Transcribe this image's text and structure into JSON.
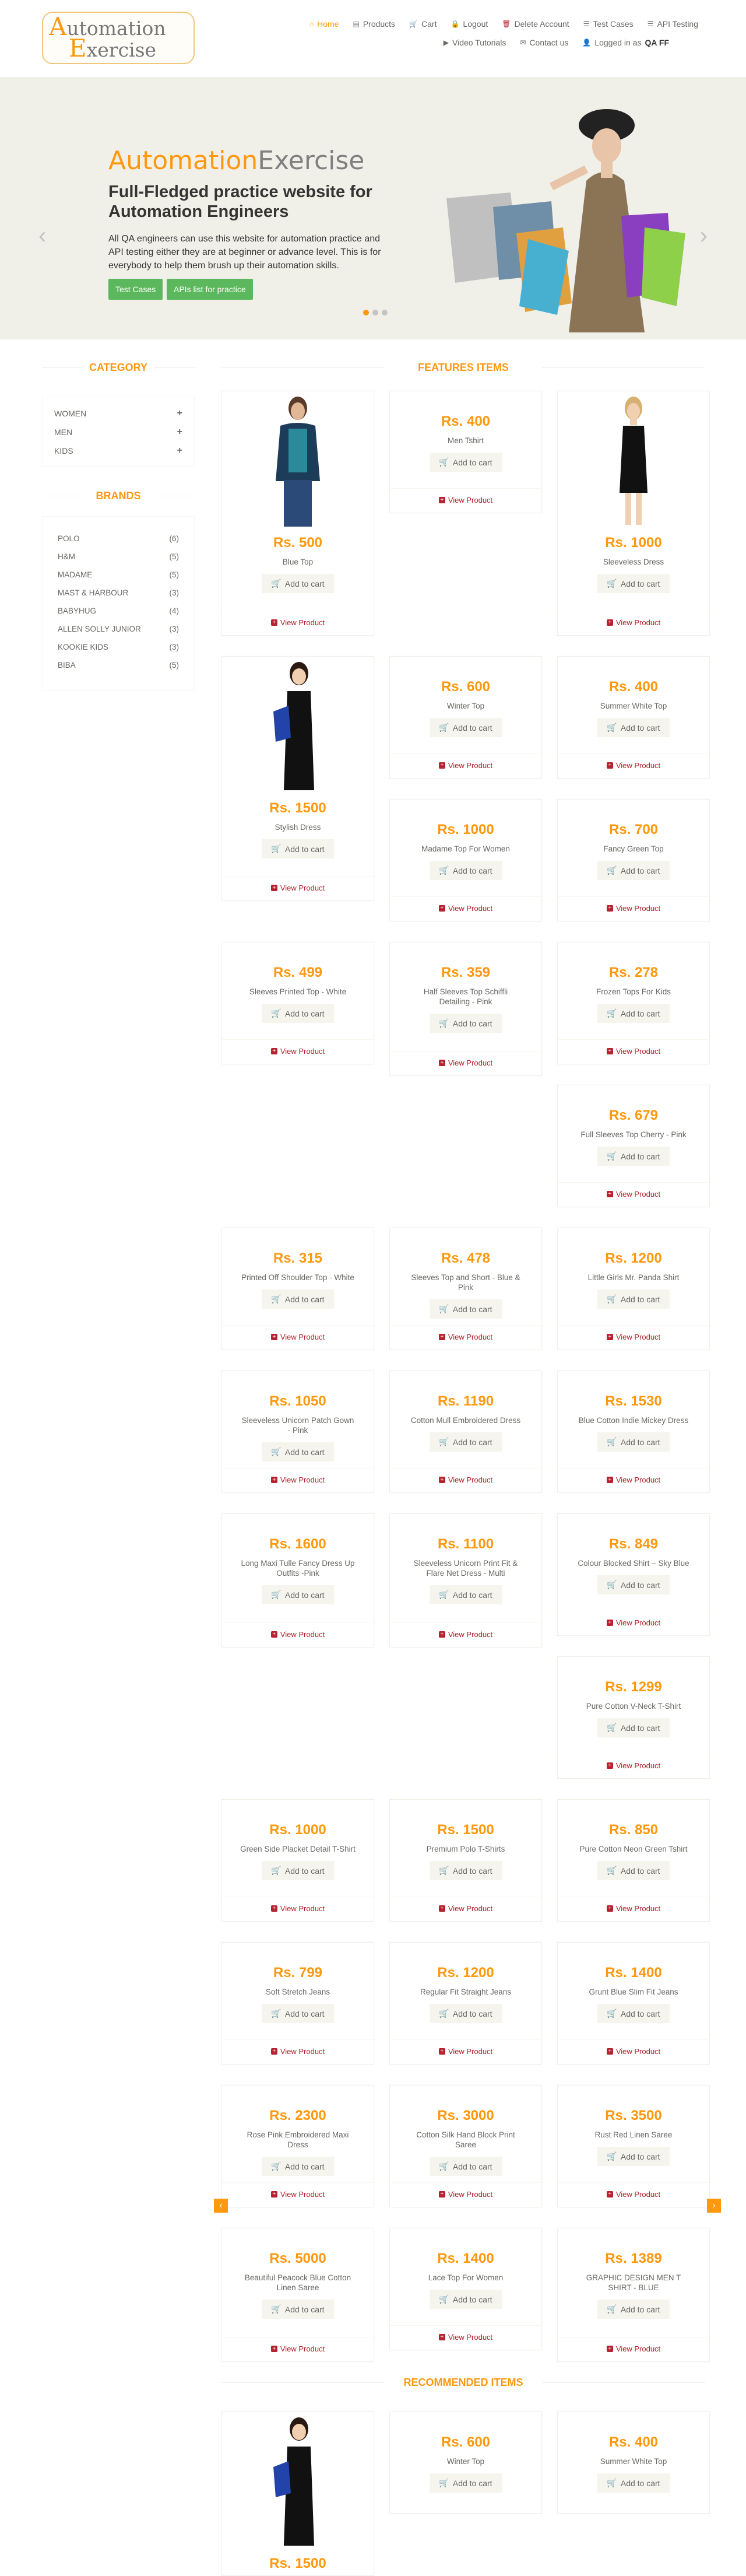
{
  "header": {
    "logo": {
      "line1_first": "A",
      "line1_rest": "utomation",
      "line2_first": "E",
      "line2_rest": "xercise"
    },
    "nav": [
      {
        "label": "Home",
        "icon": "home-icon",
        "glyph": "⌂"
      },
      {
        "label": "Products",
        "icon": "products-icon",
        "glyph": "▤"
      },
      {
        "label": "Cart",
        "icon": "cart-icon",
        "glyph": "🛒"
      },
      {
        "label": "Logout",
        "icon": "lock-icon",
        "glyph": "🔒"
      },
      {
        "label": "Delete Account",
        "icon": "trash-icon",
        "glyph": "🗑"
      },
      {
        "label": "Test Cases",
        "icon": "list-icon",
        "glyph": "☰"
      },
      {
        "label": "API Testing",
        "icon": "list-icon",
        "glyph": "☰"
      },
      {
        "label": "Video Tutorials",
        "icon": "youtube-icon",
        "glyph": "▶"
      },
      {
        "label": "Contact us",
        "icon": "envelope-icon",
        "glyph": "✉"
      }
    ],
    "logged_prefix": "Logged in as",
    "logged_user": "QA FF"
  },
  "slider": {
    "title_part1": "Automation",
    "title_part2": "Exercise",
    "subtitle": "Full-Fledged practice website for Automation Engineers",
    "description": "All QA engineers can use this website for automation practice and API testing either they are at beginner or advance level. This is for everybody to help them brush up their automation skills.",
    "btn_test_cases": "Test Cases",
    "btn_apis": "APIs list for practice"
  },
  "sidebar": {
    "category_title": "CATEGORY",
    "categories": [
      "WOMEN",
      "MEN",
      "KIDS"
    ],
    "brands_title": "BRANDS",
    "brands": [
      {
        "name": "POLO",
        "count": "(6)"
      },
      {
        "name": "H&M",
        "count": "(5)"
      },
      {
        "name": "MADAME",
        "count": "(5)"
      },
      {
        "name": "MAST & HARBOUR",
        "count": "(3)"
      },
      {
        "name": "BABYHUG",
        "count": "(4)"
      },
      {
        "name": "ALLEN SOLLY JUNIOR",
        "count": "(3)"
      },
      {
        "name": "KOOKIE KIDS",
        "count": "(3)"
      },
      {
        "name": "BIBA",
        "count": "(5)"
      }
    ]
  },
  "features_title": "FEATURES ITEMS",
  "recommended_title": "RECOMMENDED ITEMS",
  "add_to_cart": "Add to cart",
  "view_product": "View Product",
  "products": [
    {
      "price": "Rs. 500",
      "name": "Blue Top"
    },
    {
      "price": "Rs. 400",
      "name": "Men Tshirt"
    },
    {
      "price": "Rs. 1000",
      "name": "Sleeveless Dress"
    },
    {
      "price": "Rs. 1500",
      "name": "Stylish Dress"
    },
    {
      "price": "Rs. 600",
      "name": "Winter Top"
    },
    {
      "price": "Rs. 400",
      "name": "Summer White Top"
    },
    {
      "price": "Rs. 1000",
      "name": "Madame Top For Women"
    },
    {
      "price": "Rs. 700",
      "name": "Fancy Green Top"
    },
    {
      "price": "Rs. 499",
      "name": "Sleeves Printed Top - White"
    },
    {
      "price": "Rs. 359",
      "name": "Half Sleeves Top Schiffli Detailing - Pink"
    },
    {
      "price": "Rs. 278",
      "name": "Frozen Tops For Kids"
    },
    {
      "price": "Rs. 679",
      "name": "Full Sleeves Top Cherry - Pink"
    },
    {
      "price": "Rs. 315",
      "name": "Printed Off Shoulder Top - White"
    },
    {
      "price": "Rs. 478",
      "name": "Sleeves Top and Short - Blue & Pink"
    },
    {
      "price": "Rs. 1200",
      "name": "Little Girls Mr. Panda Shirt"
    },
    {
      "price": "Rs. 1050",
      "name": "Sleeveless Unicorn Patch Gown - Pink"
    },
    {
      "price": "Rs. 1190",
      "name": "Cotton Mull Embroidered Dress"
    },
    {
      "price": "Rs. 1530",
      "name": "Blue Cotton Indie Mickey Dress"
    },
    {
      "price": "Rs. 1600",
      "name": "Long Maxi Tulle Fancy Dress Up Outfits -Pink"
    },
    {
      "price": "Rs. 1100",
      "name": "Sleeveless Unicorn Print Fit & Flare Net Dress - Multi"
    },
    {
      "price": "Rs. 849",
      "name": "Colour Blocked Shirt – Sky Blue"
    },
    {
      "price": "Rs. 1299",
      "name": "Pure Cotton V-Neck T-Shirt"
    },
    {
      "price": "Rs. 1000",
      "name": "Green Side Placket Detail T-Shirt"
    },
    {
      "price": "Rs. 1500",
      "name": "Premium Polo T-Shirts"
    },
    {
      "price": "Rs. 850",
      "name": "Pure Cotton Neon Green Tshirt"
    },
    {
      "price": "Rs. 799",
      "name": "Soft Stretch Jeans"
    },
    {
      "price": "Rs. 1200",
      "name": "Regular Fit Straight Jeans"
    },
    {
      "price": "Rs. 1400",
      "name": "Grunt Blue Slim Fit Jeans"
    },
    {
      "price": "Rs. 2300",
      "name": "Rose Pink Embroidered Maxi Dress"
    },
    {
      "price": "Rs. 3000",
      "name": "Cotton Silk Hand Block Print Saree"
    },
    {
      "price": "Rs. 3500",
      "name": "Rust Red Linen Saree"
    },
    {
      "price": "Rs. 5000",
      "name": "Beautiful Peacock Blue Cotton Linen Saree"
    },
    {
      "price": "Rs. 1400",
      "name": "Lace Top For Women"
    },
    {
      "price": "Rs. 1389",
      "name": "GRAPHIC DESIGN MEN T SHIRT - BLUE"
    }
  ],
  "recommended": [
    {
      "price": "Rs. 1500",
      "name": ""
    },
    {
      "price": "Rs. 600",
      "name": "Winter Top"
    },
    {
      "price": "Rs. 400",
      "name": "Summer White Top"
    }
  ],
  "colors": {
    "accent": "#FE980F",
    "view_red": "#B4232F",
    "button_green": "#5cb85c",
    "slider_bg": "#f0f0e9"
  }
}
